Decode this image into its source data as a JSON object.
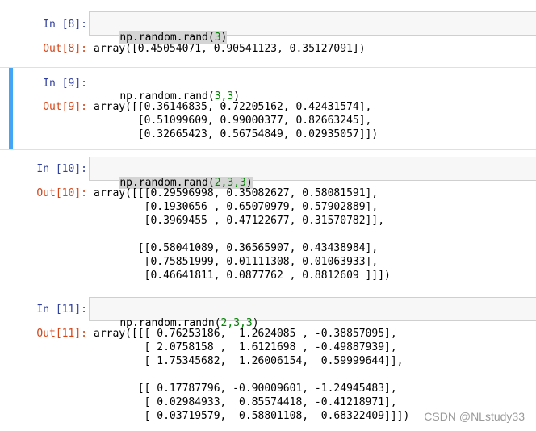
{
  "cells": [
    {
      "in_prompt": "In [8]:",
      "code_pre": "np.random.rand(",
      "code_args": "3",
      "code_post": ")",
      "out_prompt": "Out[8]:",
      "output": "array([0.45054071, 0.90541123, 0.35127091])"
    },
    {
      "in_prompt": "In [9]:",
      "code_pre": "np.random.rand(",
      "code_args": "3,3",
      "code_post": ")",
      "out_prompt": "Out[9]:",
      "output": "array([[0.36146835, 0.72205162, 0.42431574],\n       [0.51099609, 0.99000377, 0.82663245],\n       [0.32665423, 0.56754849, 0.02935057]])"
    },
    {
      "in_prompt": "In [10]:",
      "code_pre": "np.random.rand(",
      "code_args": "2,3,3",
      "code_post": ")",
      "out_prompt": "Out[10]:",
      "output": "array([[[0.29596998, 0.35082627, 0.58081591],\n        [0.1930656 , 0.65070979, 0.57902889],\n        [0.3969455 , 0.47122677, 0.31570782]],\n\n       [[0.58041089, 0.36565907, 0.43438984],\n        [0.75851999, 0.01111308, 0.01063933],\n        [0.46641811, 0.0877762 , 0.8812609 ]]])"
    },
    {
      "in_prompt": "In [11]:",
      "code_pre": "np.random.randn(",
      "code_args": "2,3,3",
      "code_post": ")",
      "out_prompt": "Out[11]:",
      "output": "array([[[ 0.76253186,  1.2624085 , -0.38857095],\n        [ 2.0758158 ,  1.6121698 , -0.49887939],\n        [ 1.75345682,  1.26006154,  0.59999644]],\n\n       [[ 0.17787796, -0.90009601, -1.24945483],\n        [ 0.02984933,  0.85574418, -0.41218971],\n        [ 0.03719579,  0.58801108,  0.68322409]]])"
    }
  ],
  "watermark": "CSDN @NLstudy33",
  "colors": {
    "in_prompt": "#303f9f",
    "out_prompt": "#d84315",
    "selected_bar": "#42a5f5",
    "number": "#008000"
  }
}
